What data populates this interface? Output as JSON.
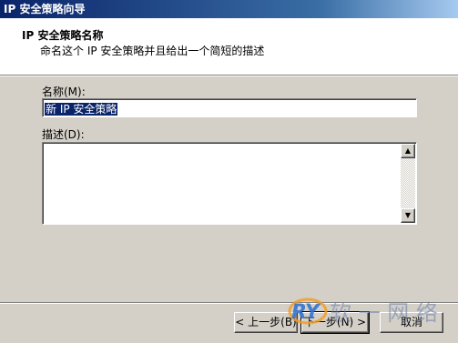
{
  "window": {
    "title": "IP 安全策略向导"
  },
  "header": {
    "title": "IP 安全策略名称",
    "subtitle": "命名这个 IP 安全策略并且给出一个简短的描述"
  },
  "form": {
    "name_label": "名称(M):",
    "name_value": "新 IP 安全策略",
    "description_label": "描述(D):",
    "description_value": ""
  },
  "buttons": {
    "back": "< 上一步(B)",
    "next": "下一步(N) >",
    "cancel": "取消"
  },
  "watermark": {
    "logo_text": "RY",
    "text": "软 一 网 络"
  },
  "colors": {
    "titlebar": "#0a246a",
    "face": "#d4d0c8",
    "selection": "#0a246a"
  }
}
